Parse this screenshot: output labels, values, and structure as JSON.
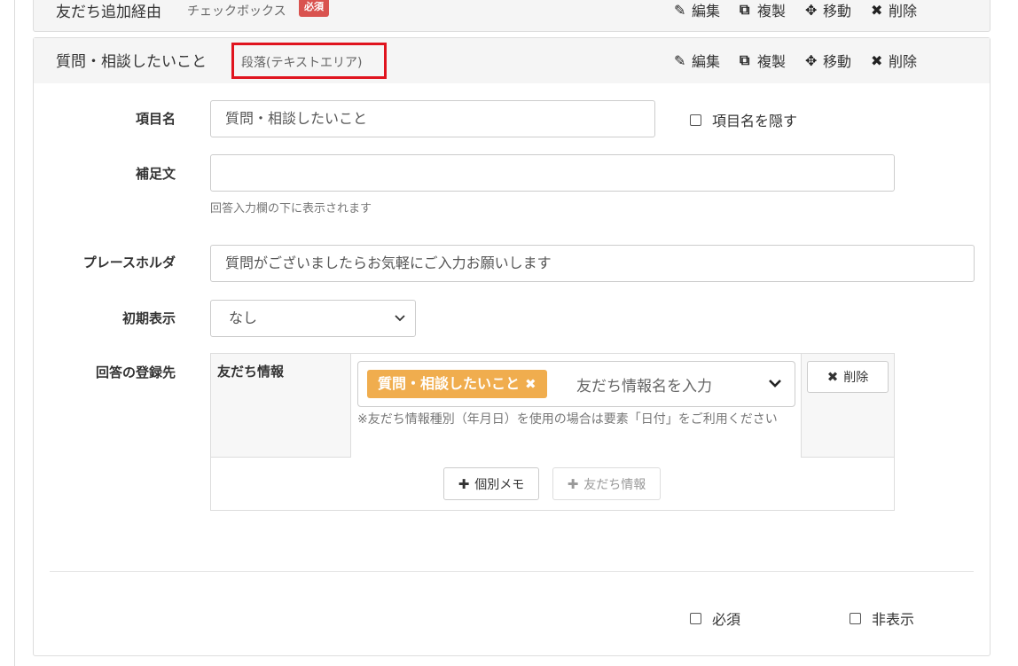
{
  "prev_item": {
    "title": "友だち追加経由",
    "type": "チェックボックス",
    "required_badge": "必須"
  },
  "actions": {
    "edit": "編集",
    "duplicate": "複製",
    "move": "移動",
    "delete": "削除"
  },
  "item": {
    "title": "質問・相談したいこと",
    "type": "段落(テキストエリア)"
  },
  "form": {
    "item_name": {
      "label": "項目名",
      "value": "質問・相談したいこと",
      "hide_label": "項目名を隠す"
    },
    "supplement": {
      "label": "補足文",
      "value": "",
      "help": "回答入力欄の下に表示されます"
    },
    "placeholder": {
      "label": "プレースホルダ",
      "value": "質問がございましたらお気軽にご入力お願いします"
    },
    "initial_display": {
      "label": "初期表示",
      "selected": "なし"
    },
    "destination": {
      "label": "回答の登録先",
      "row_label": "友だち情報",
      "tag": "質問・相談したいこと",
      "tag_placeholder": "友だち情報名を入力",
      "note": "※友だち情報種別（年月日）を使用の場合は要素「日付」をご利用ください",
      "delete_button": "削除",
      "add_memo_button": "個別メモ",
      "add_friend_info_button": "友だち情報"
    }
  },
  "footer": {
    "required_label": "必須",
    "hidden_label": "非表示"
  },
  "colors": {
    "tag_bg": "#f0ad4e",
    "badge_bg": "#d9534f",
    "highlight_border": "#e0141e"
  }
}
